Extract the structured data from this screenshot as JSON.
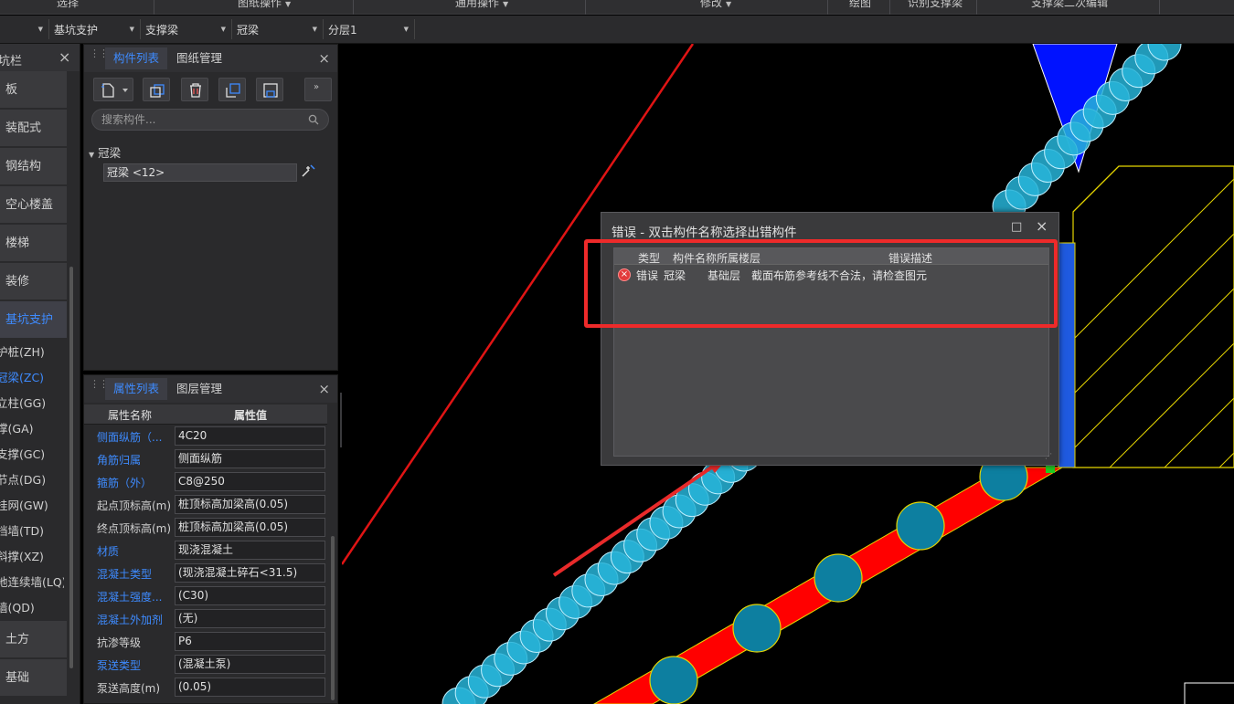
{
  "ribbon": {
    "groups": [
      "选择",
      "图纸操作",
      "通用操作",
      "修改",
      "绘图",
      "识别支撑梁",
      "支撑梁二次编辑"
    ],
    "combos": [
      "",
      "基坑支护",
      "支撑梁",
      "冠梁",
      "分层1"
    ]
  },
  "leftnav": {
    "title": "坑栏",
    "categories": [
      "板",
      "装配式",
      "钢结构",
      "空心楼盖",
      "楼梯",
      "装修",
      "基坑支护",
      "土方",
      "基础"
    ],
    "subitems": [
      "护桩(ZH)",
      "冠梁(ZC)",
      "立柱(GG)",
      "撑(GA)",
      "支撑(GC)",
      "节点(DG)",
      "挂网(GW)",
      "挡墙(TD)",
      "斜撑(XZ)",
      "地连续墙(LQ)",
      "墙(QD)"
    ]
  },
  "component_panel": {
    "tabs": [
      "构件列表",
      "图纸管理"
    ],
    "search_placeholder": "搜索构件...",
    "group": "冠梁",
    "item": "冠梁 <12>"
  },
  "property_panel": {
    "tabs": [
      "属性列表",
      "图层管理"
    ],
    "col_name": "属性名称",
    "col_value": "属性值",
    "rows": [
      {
        "name": "侧面纵筋（...",
        "value": "4C20",
        "link": true
      },
      {
        "name": "角筋归属",
        "value": "侧面纵筋",
        "link": true
      },
      {
        "name": "箍筋（外）",
        "value": "C8@250",
        "link": true
      },
      {
        "name": "起点顶标高(m)",
        "value": "桩顶标高加梁高(0.05)",
        "link": false
      },
      {
        "name": "终点顶标高(m)",
        "value": "桩顶标高加梁高(0.05)",
        "link": false
      },
      {
        "name": "材质",
        "value": "现浇混凝土",
        "link": true
      },
      {
        "name": "混凝土类型",
        "value": "(现浇混凝土碎石<31.5)",
        "link": true
      },
      {
        "name": "混凝土强度...",
        "value": "(C30)",
        "link": true
      },
      {
        "name": "混凝土外加剂",
        "value": "(无)",
        "link": true
      },
      {
        "name": "抗渗等级",
        "value": "P6",
        "link": false
      },
      {
        "name": "泵送类型",
        "value": "(混凝土泵)",
        "link": true
      },
      {
        "name": "泵送高度(m)",
        "value": "(0.05)",
        "link": false
      }
    ]
  },
  "error_dialog": {
    "title": "错误 - 双击构件名称选择出错构件",
    "headers": [
      "类型",
      "构件名称",
      "所属楼层",
      "错误描述"
    ],
    "row": {
      "type": "错误",
      "name": "冠梁",
      "floor": "基础层",
      "desc": "截面布筋参考线不合法，请检查图元"
    }
  },
  "colors": {
    "accent_blue": "#3e8bff",
    "error_red": "#e23b3b",
    "beam_red": "#ff0000",
    "pile_cyan": "#27b4d8",
    "hatch_yellow": "#e6d600"
  }
}
